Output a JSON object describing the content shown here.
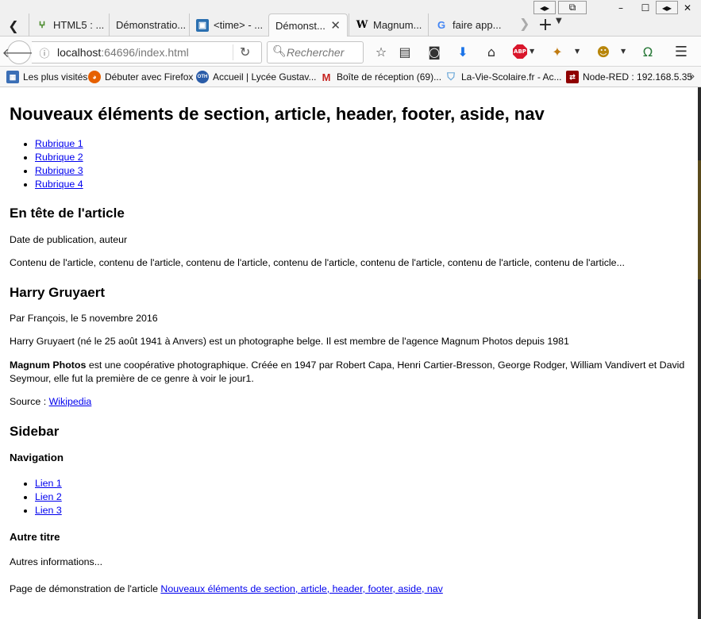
{
  "tabs": [
    {
      "title": "HTML5 : ...",
      "icon": "tree-favicon-icon",
      "active": false
    },
    {
      "title": "Démonstratio...",
      "icon": "none",
      "active": false
    },
    {
      "title": "<time> - ...",
      "icon": "image-favicon-icon",
      "active": false
    },
    {
      "title": "Démonst...",
      "icon": "none",
      "active": true
    },
    {
      "title": "Magnum...",
      "icon": "wikipedia-favicon-icon",
      "active": false
    },
    {
      "title": "faire app...",
      "icon": "google-favicon-icon",
      "active": false
    }
  ],
  "navbar": {
    "url_host": "localhost",
    "url_rest": ":64696/index.html",
    "search_placeholder": "Rechercher"
  },
  "bookmarks": [
    {
      "label": "Les plus visités",
      "icon": "bookmark-folder-icon"
    },
    {
      "label": "Débuter avec Firefox",
      "icon": "firefox-icon"
    },
    {
      "label": "Accueil | Lycée Gustav...",
      "icon": "school-icon"
    },
    {
      "label": "Boîte de réception (69)...",
      "icon": "gmail-icon"
    },
    {
      "label": "La-Vie-Scolaire.fr - Ac...",
      "icon": "shield-icon"
    },
    {
      "label": "Node-RED : 192.168.5.35",
      "icon": "node-red-icon"
    }
  ],
  "page": {
    "h1": "Nouveaux éléments de section, article, header, footer, aside, nav",
    "nav_items": [
      "Rubrique 1",
      "Rubrique 2",
      "Rubrique 3",
      "Rubrique 4"
    ],
    "article1": {
      "heading": "En tête de l'article",
      "meta": "Date de publication, auteur",
      "content": "Contenu de l'article, contenu de l'article, contenu de l'article, contenu de l'article, contenu de l'article, contenu de l'article, contenu de l'article..."
    },
    "article2": {
      "heading": "Harry Gruyaert",
      "meta": "Par François, le 5 novembre 2016",
      "p1": "Harry Gruyaert (né le 25 août 1941 à Anvers) est un photographe belge. Il est membre de l'agence Magnum Photos depuis 1981",
      "p2_bold": "Magnum Photos",
      "p2_rest": " est une coopérative photographique. Créée en 1947 par Robert Capa, Henri Cartier-Bresson, George Rodger, William Vandivert et David Seymour, elle fut la première de ce genre à voir le jour1.",
      "source_label": "Source : ",
      "source_link": "Wikipedia"
    },
    "sidebar": {
      "heading": "Sidebar",
      "nav_heading": "Navigation",
      "links": [
        "Lien 1",
        "Lien 2",
        "Lien 3"
      ],
      "other_heading": "Autre titre",
      "other_text": "Autres informations..."
    },
    "footer": {
      "text": "Page de démonstration de l'article ",
      "link": "Nouveaux éléments de section, article, header, footer, aside, nav"
    }
  }
}
